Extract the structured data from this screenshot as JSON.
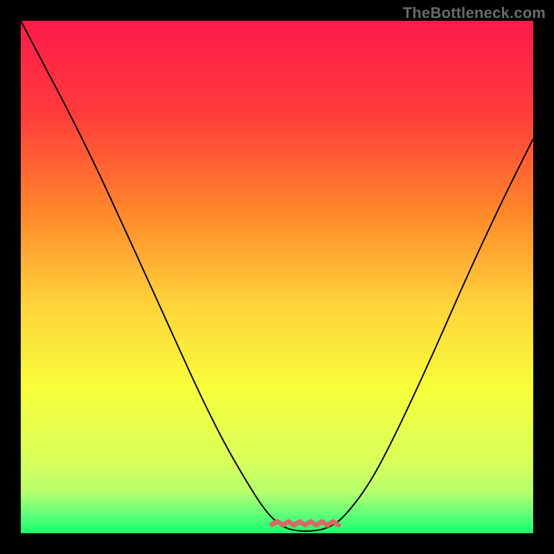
{
  "watermark": "TheBottleneck.com",
  "colors": {
    "frame": "#000000",
    "curve": "#000000",
    "marker": "#d66a66",
    "gradient_stops": [
      {
        "offset": 0.0,
        "color": "#ff1a4b"
      },
      {
        "offset": 0.18,
        "color": "#ff3b3b"
      },
      {
        "offset": 0.38,
        "color": "#ff8a2a"
      },
      {
        "offset": 0.55,
        "color": "#ffd23a"
      },
      {
        "offset": 0.72,
        "color": "#f7ff3a"
      },
      {
        "offset": 0.86,
        "color": "#d8ff5a"
      },
      {
        "offset": 0.92,
        "color": "#b6ff6e"
      },
      {
        "offset": 0.965,
        "color": "#5dff7a"
      },
      {
        "offset": 1.0,
        "color": "#18ff6a"
      }
    ]
  },
  "chart_data": {
    "type": "line",
    "title": "",
    "xlabel": "",
    "ylabel": "",
    "xlim": [
      0,
      1
    ],
    "ylim": [
      0,
      1
    ],
    "series": [
      {
        "name": "bottleneck-curve",
        "x": [
          0.0,
          0.05,
          0.1,
          0.15,
          0.2,
          0.25,
          0.3,
          0.35,
          0.4,
          0.45,
          0.48,
          0.51,
          0.54,
          0.57,
          0.6,
          0.63,
          0.68,
          0.73,
          0.8,
          0.87,
          0.94,
          1.0
        ],
        "y": [
          1.0,
          0.905,
          0.81,
          0.708,
          0.6,
          0.49,
          0.38,
          0.27,
          0.17,
          0.085,
          0.04,
          0.012,
          0.004,
          0.004,
          0.01,
          0.03,
          0.095,
          0.19,
          0.34,
          0.5,
          0.65,
          0.77
        ]
      }
    ],
    "annotations": [
      {
        "name": "trough-marker",
        "x_range": [
          0.49,
          0.62
        ],
        "y": 0.02,
        "color": "#d66a66"
      }
    ]
  }
}
